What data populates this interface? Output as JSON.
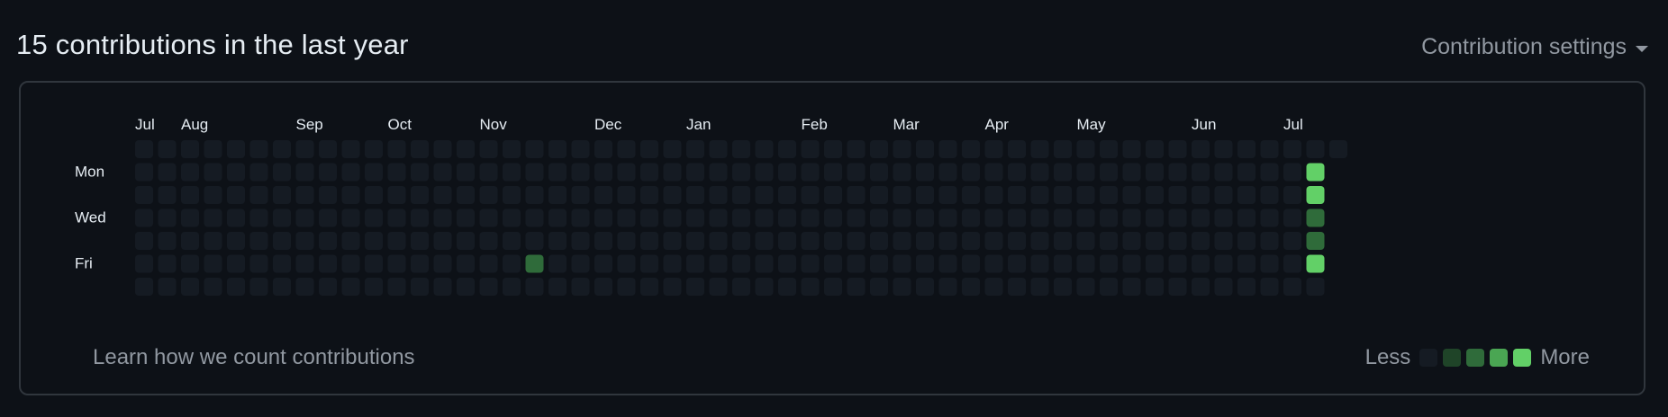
{
  "header": {
    "title": "15 contributions in the last year",
    "settings_label": "Contribution settings"
  },
  "graph": {
    "months": [
      {
        "label": "Jul",
        "week": 0
      },
      {
        "label": "Aug",
        "week": 2
      },
      {
        "label": "Sep",
        "week": 7
      },
      {
        "label": "Oct",
        "week": 11
      },
      {
        "label": "Nov",
        "week": 15
      },
      {
        "label": "Dec",
        "week": 20
      },
      {
        "label": "Jan",
        "week": 24
      },
      {
        "label": "Feb",
        "week": 29
      },
      {
        "label": "Mar",
        "week": 33
      },
      {
        "label": "Apr",
        "week": 37
      },
      {
        "label": "May",
        "week": 41
      },
      {
        "label": "Jun",
        "week": 46
      },
      {
        "label": "Jul",
        "week": 50
      }
    ],
    "days": [
      {
        "label": "Mon",
        "row": 1
      },
      {
        "label": "Wed",
        "row": 3
      },
      {
        "label": "Fri",
        "row": 5
      }
    ],
    "weeks": 53,
    "last_week_days": 1,
    "contributions": [
      {
        "week": 17,
        "day": 5,
        "level": 2
      },
      {
        "week": 51,
        "day": 1,
        "level": 4
      },
      {
        "week": 51,
        "day": 2,
        "level": 4
      },
      {
        "week": 51,
        "day": 3,
        "level": 2
      },
      {
        "week": 51,
        "day": 4,
        "level": 2
      },
      {
        "week": 51,
        "day": 5,
        "level": 4
      }
    ],
    "level_colors": [
      "#161b22",
      "#0e4429",
      "#006d32",
      "#26a641",
      "#39d353"
    ],
    "display_colors": [
      "#151b23",
      "#1f4428",
      "#2f6b3a",
      "#4aa653",
      "#62d067"
    ]
  },
  "footer": {
    "learn_link": "Learn how we count contributions",
    "legend_less": "Less",
    "legend_more": "More"
  }
}
